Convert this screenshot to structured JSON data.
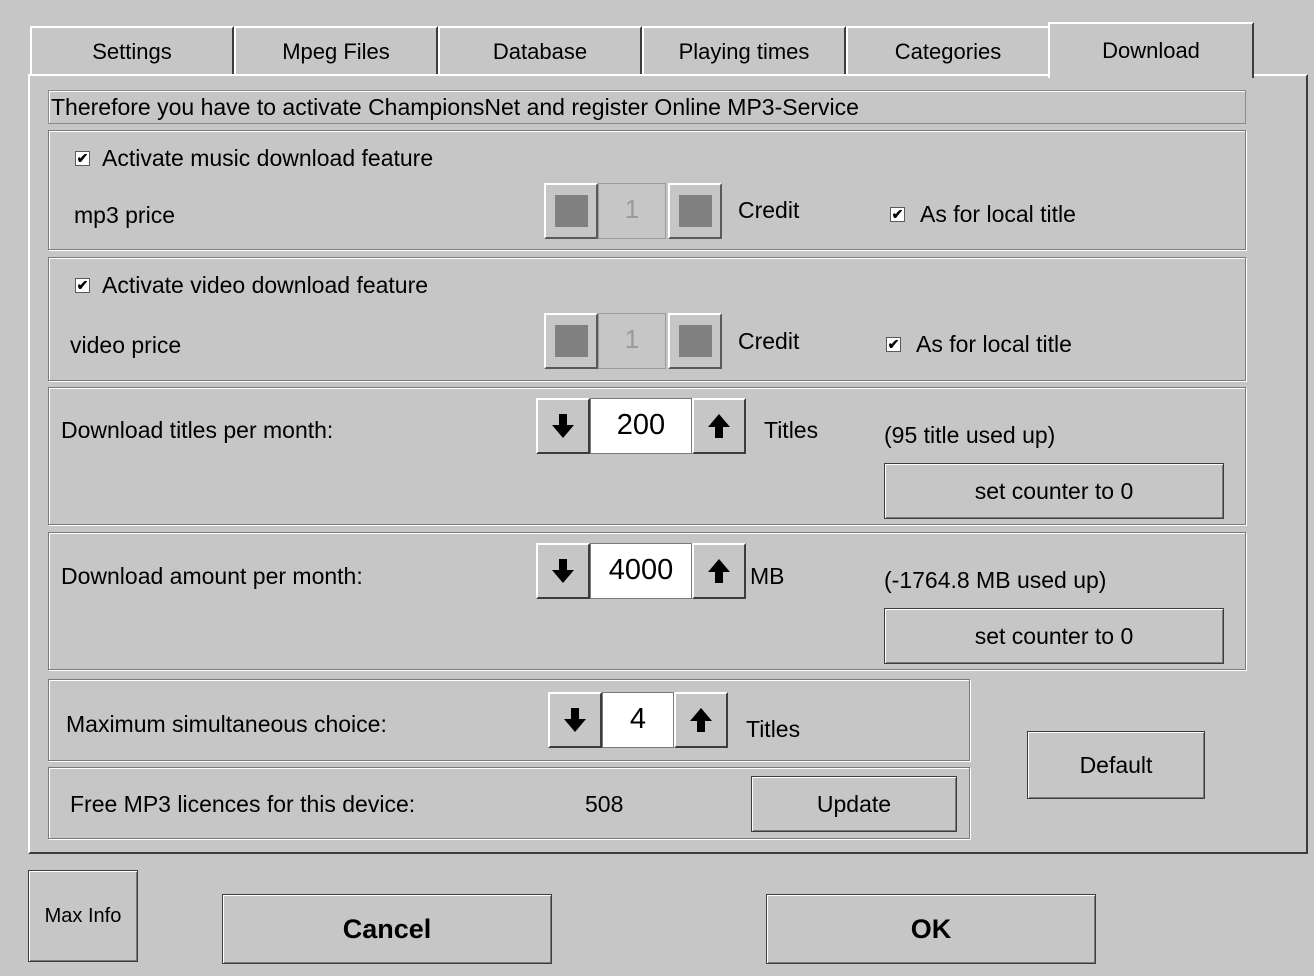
{
  "tabs": [
    {
      "label": "Settings"
    },
    {
      "label": "Mpeg Files"
    },
    {
      "label": "Database"
    },
    {
      "label": "Playing times"
    },
    {
      "label": "Categories"
    },
    {
      "label": "Download",
      "active": true
    }
  ],
  "info_text": "Therefore you have to activate ChampionsNet and register Online MP3-Service",
  "music": {
    "checkbox_label": "Activate music download feature",
    "checked": true,
    "price_label": "mp3 price",
    "price_value": "1",
    "unit": "Credit",
    "local_label": "As for local title",
    "local_checked": true
  },
  "video": {
    "checkbox_label": "Activate video download feature",
    "checked": true,
    "price_label": "video price",
    "price_value": "1",
    "unit": "Credit",
    "local_label": "As for local title",
    "local_checked": true
  },
  "titles_per_month": {
    "label": "Download titles per month:",
    "value": "200",
    "unit": "Titles",
    "used": "(95 title used up)",
    "reset_label": "set counter to 0"
  },
  "amount_per_month": {
    "label": "Download amount per month:",
    "value": "4000",
    "unit": "MB",
    "used": "(-1764.8 MB used up)",
    "reset_label": "set counter to 0"
  },
  "max_choice": {
    "label": "Maximum simultaneous choice:",
    "value": "4",
    "unit": "Titles"
  },
  "licences": {
    "label": "Free MP3 licences for this device:",
    "value": "508",
    "update_label": "Update"
  },
  "default_label": "Default",
  "footer": {
    "max_info_label": "Max Info",
    "cancel_label": "Cancel",
    "ok_label": "OK"
  },
  "icons": {
    "check": "✔",
    "down_arrow": "arrow-down-icon",
    "up_arrow": "arrow-up-icon"
  }
}
